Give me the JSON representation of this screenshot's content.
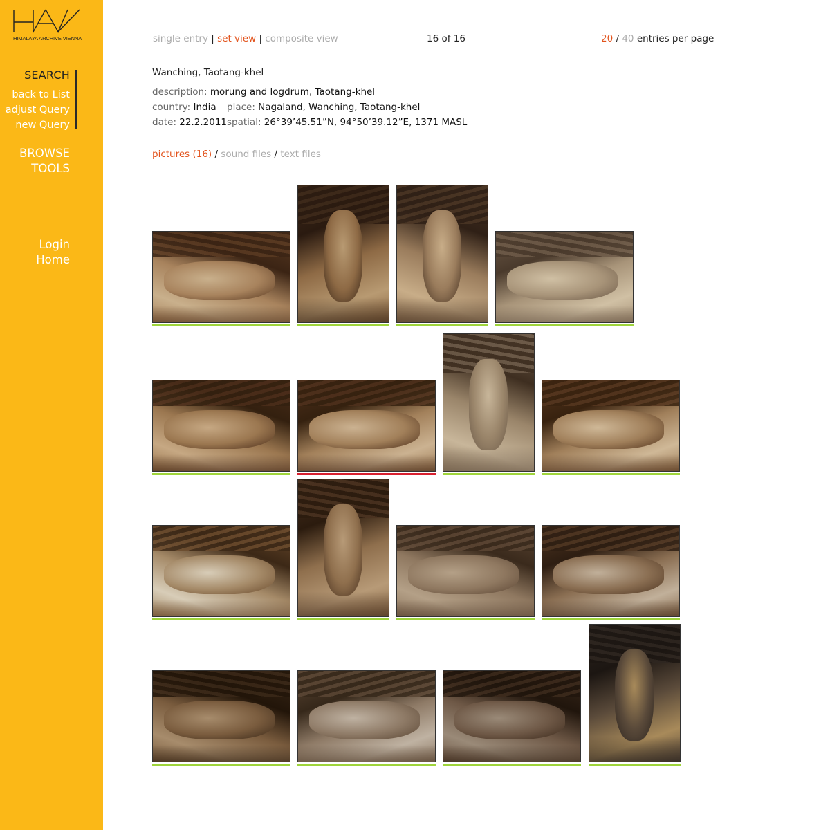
{
  "sidebar": {
    "logo_letters": "HAV",
    "logo_subtitle": "HIMALAYA ARCHIVE VIENNA",
    "search_label": "SEARCH",
    "search_items": [
      {
        "label": "back to List"
      },
      {
        "label": "adjust Query"
      },
      {
        "label": "new Query"
      }
    ],
    "browse_label": "BROWSE",
    "tools_label": "TOOLS",
    "login_label": "Login",
    "home_label": "Home"
  },
  "topbar": {
    "view_modes": [
      {
        "label": "single entry",
        "active": false
      },
      {
        "label": "set view",
        "active": true
      },
      {
        "label": "composite view",
        "active": false
      }
    ],
    "separator": "|",
    "counter": "16 of 16",
    "per_page_options": [
      {
        "label": "20",
        "active": true
      },
      {
        "label": "40",
        "active": false
      }
    ],
    "per_page_separator": "/",
    "per_page_suffix": "entries per page"
  },
  "record": {
    "title": "Wanching, Taotang-khel",
    "description_label": "description:",
    "description_value": "morung and logdrum, Taotang-khel",
    "country_label": "country:",
    "country_value": "India",
    "place_label": "place:",
    "place_value": "Nagaland, Wanching, Taotang-khel",
    "date_label": "date:",
    "date_value": "22.2.2011",
    "spatial_label": "spatial:",
    "spatial_value": "26°39’45.51”N, 94°50’39.12”E, 1371 MASL"
  },
  "file_tabs": {
    "pictures": "pictures (16)",
    "sound": "sound files",
    "text": "text files",
    "separator": "/"
  },
  "colors": {
    "sidebar_bg": "#fbb817",
    "accent": "#e2521b",
    "inactive_text": "#aaaaaa",
    "thumb_underline": "#9fd43b",
    "selected_underline": "#d8202f"
  },
  "thumbnails": [
    {
      "subject": "carved logdrum head with patterned body",
      "orientation": "landscape",
      "selected": false
    },
    {
      "subject": "carved wooden hornbill head under roof",
      "orientation": "portrait",
      "selected": false
    },
    {
      "subject": "carved drum end viewed from front",
      "orientation": "portrait",
      "selected": false
    },
    {
      "subject": "carved logdrum head viewed from above",
      "orientation": "landscape",
      "selected": false
    },
    {
      "subject": "logdrum body with carved patterns",
      "orientation": "landscape",
      "selected": false
    },
    {
      "subject": "logdrum head with carved nostrils",
      "orientation": "landscape",
      "selected": true
    },
    {
      "subject": "logdrum viewed lengthwise from end",
      "orientation": "portrait",
      "selected": false
    },
    {
      "subject": "logdrum head carved foot shape",
      "orientation": "landscape",
      "selected": false
    },
    {
      "subject": "morung interior with carved posts",
      "orientation": "landscape",
      "selected": false
    },
    {
      "subject": "logdrum tip under roof beams",
      "orientation": "portrait",
      "selected": false
    },
    {
      "subject": "carved wooden panel with geometric pattern",
      "orientation": "landscape",
      "selected": false
    },
    {
      "subject": "carved beam under thatched roof",
      "orientation": "landscape",
      "selected": false
    },
    {
      "subject": "logdrum under corrugated roof",
      "orientation": "landscape",
      "selected": false
    },
    {
      "subject": "striped logdrum body in hall",
      "orientation": "landscape",
      "selected": false
    },
    {
      "subject": "morung hall interior wide view",
      "orientation": "landscape",
      "selected": false
    },
    {
      "subject": "woven basket trophy hanging from roof",
      "orientation": "portrait",
      "selected": false
    }
  ]
}
